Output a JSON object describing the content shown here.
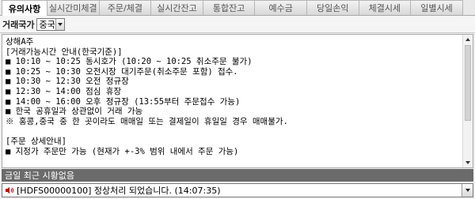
{
  "tabs": [
    {
      "label": "유의사항",
      "active": true
    },
    {
      "label": "실시간미체결",
      "active": false
    },
    {
      "label": "주문/체결",
      "active": false
    },
    {
      "label": "실시간잔고",
      "active": false
    },
    {
      "label": "통합잔고",
      "active": false
    },
    {
      "label": "예수금",
      "active": false
    },
    {
      "label": "당일손익",
      "active": false
    },
    {
      "label": "체결시세",
      "active": false
    },
    {
      "label": "일별시세",
      "active": false
    }
  ],
  "filter": {
    "label": "거래국가",
    "country_value": "중국"
  },
  "notice": {
    "lines": [
      "상해A주",
      "[거래가능시간 안내(한국기준)]",
      "■ 10:10 ~ 10:25 동시호가 (10:20 ~ 10:25 취소주문 불가)",
      "■ 10:25 ~ 10:30 오전시장 대기주문(취소주문 포함) 접수.",
      "■ 10:30 ~ 12:30 오전 정규장",
      "■ 12:30 ~ 14:00 점심 휴장",
      "■ 14:00 ~ 16:00 오후 정규장 (13:55부터 주문접수 가능)",
      "■ 한국 공휴일과 상관없이 거래 가능",
      "※ 홍콩,중국 중 한 곳이라도 매매일 또는 결제일이 휴일일 경우 매매불가.",
      "",
      "[주문 상세안내]",
      "■ 지정가 주문만 가능 (현재가 +-3% 범위 내에서 주문 가능)"
    ]
  },
  "status": {
    "text": "금일 최근 시황없음"
  },
  "message": {
    "text": "[HDFS00000100] 정상처리 되었습니다. (14:07:35)"
  },
  "colors": {
    "active_tab_bg": "#ffffff",
    "status_bar_bg": "#6b6b6b",
    "speaker_icon": "#c00000"
  }
}
